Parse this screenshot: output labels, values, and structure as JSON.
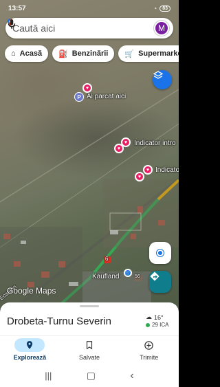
{
  "status": {
    "time": "13:57",
    "battery": "83"
  },
  "search": {
    "placeholder": "Caută aici",
    "avatar_letter": "M"
  },
  "chips": [
    {
      "icon": "home-icon",
      "label": "Acasă"
    },
    {
      "icon": "gas-station-icon",
      "label": "Benzinării"
    },
    {
      "icon": "cart-icon",
      "label": "Supermarketuri"
    }
  ],
  "map": {
    "parked_label": "Ai parcat aici",
    "indicator_1": "Indicator intro",
    "indicator_2": "Indicato",
    "kaufland": "Kaufland",
    "road_number": "6",
    "road_number2": "56",
    "street": "Ecaterin",
    "logo": "Google Maps"
  },
  "sheet": {
    "place": "Drobeta-Turnu Severin",
    "temperature": "16°",
    "aqi": "29 ICA"
  },
  "nav": [
    {
      "icon": "explore-pin-icon",
      "label": "Explorează",
      "active": true
    },
    {
      "icon": "bookmark-icon",
      "label": "Salvate",
      "active": false
    },
    {
      "icon": "add-circle-icon",
      "label": "Trimite",
      "active": false
    }
  ],
  "colors": {
    "accent": "#1a73e8",
    "brand_pink": "#e91e63",
    "nav_active": "#c2e7ff"
  }
}
